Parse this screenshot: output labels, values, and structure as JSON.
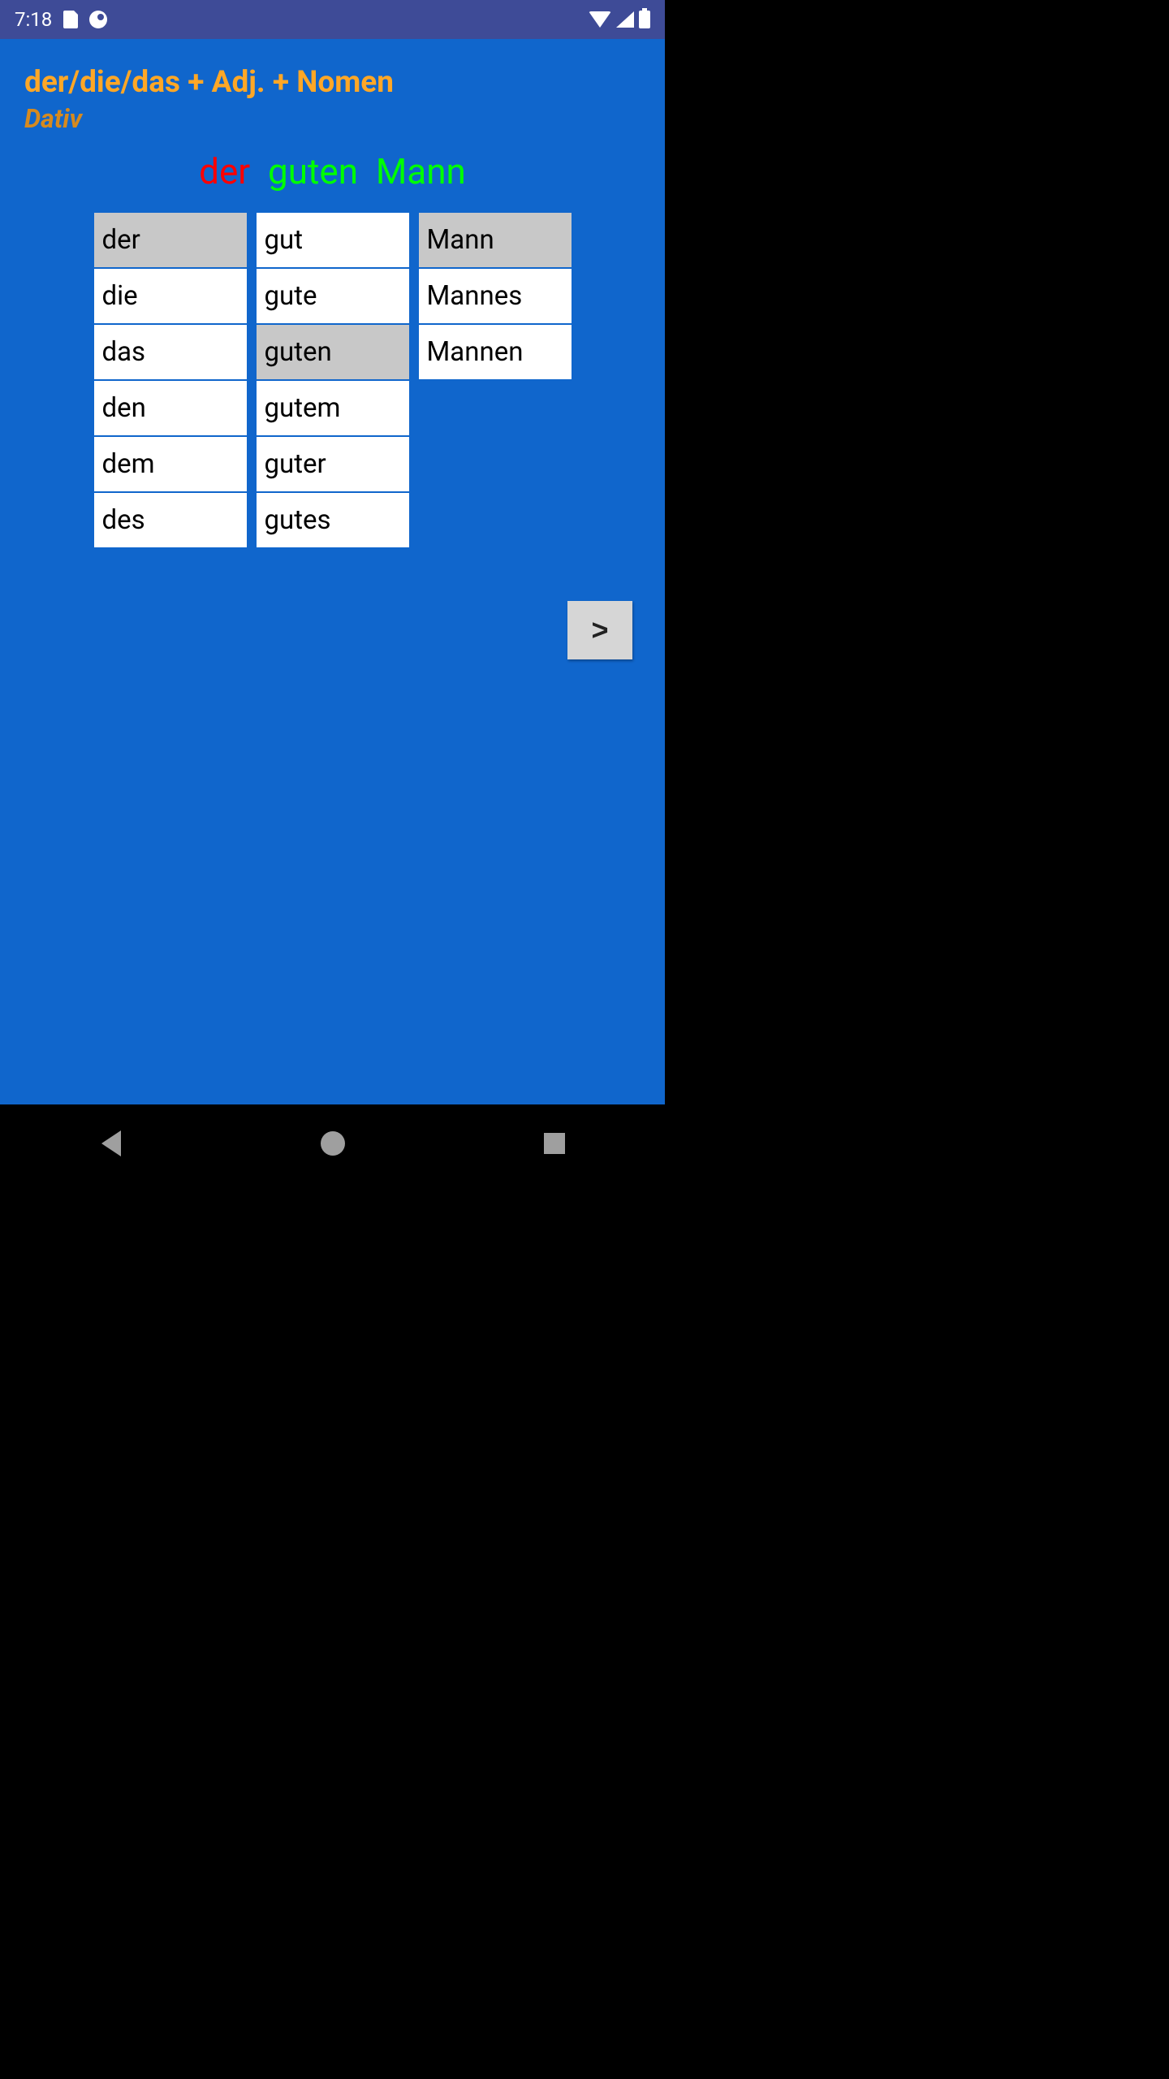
{
  "status": {
    "time": "7:18"
  },
  "header": {
    "title": "der/die/das + Adj. + Nomen",
    "subtitle": "Dativ"
  },
  "answer": {
    "article": "der",
    "adjective": "guten",
    "noun": "Mann"
  },
  "columns": {
    "articles": [
      {
        "text": "der",
        "selected": true
      },
      {
        "text": "die",
        "selected": false
      },
      {
        "text": "das",
        "selected": false
      },
      {
        "text": "den",
        "selected": false
      },
      {
        "text": "dem",
        "selected": false
      },
      {
        "text": "des",
        "selected": false
      }
    ],
    "adjectives": [
      {
        "text": "gut",
        "selected": false
      },
      {
        "text": "gute",
        "selected": false
      },
      {
        "text": "guten",
        "selected": true
      },
      {
        "text": "gutem",
        "selected": false
      },
      {
        "text": "guter",
        "selected": false
      },
      {
        "text": "gutes",
        "selected": false
      }
    ],
    "nouns": [
      {
        "text": "Mann",
        "selected": true
      },
      {
        "text": "Mannes",
        "selected": false
      },
      {
        "text": "Mannen",
        "selected": false
      }
    ]
  },
  "buttons": {
    "next": ">"
  }
}
